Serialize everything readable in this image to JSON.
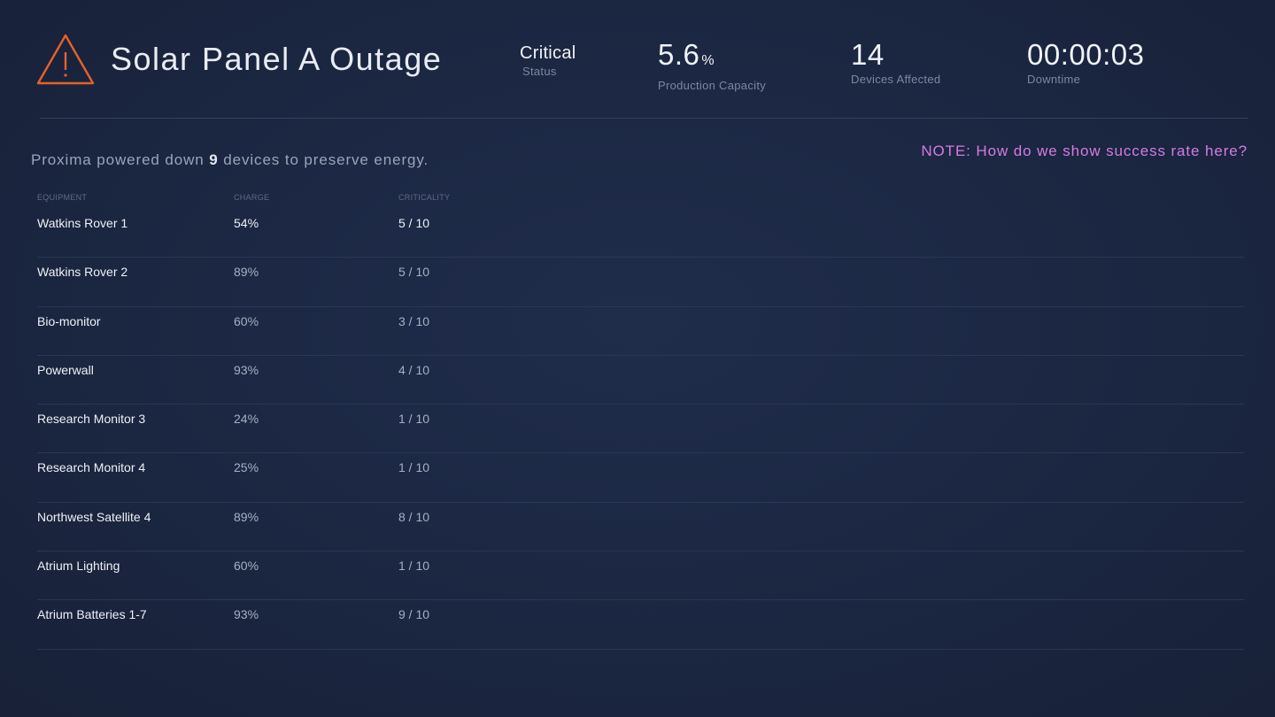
{
  "header": {
    "title": "Solar Panel A Outage",
    "icon": "warning-icon",
    "accent_color": "#e5622a",
    "stats": {
      "status": {
        "value": "Critical",
        "label": "Status"
      },
      "capacity": {
        "value": "5.6",
        "unit": "%",
        "label": "Production Capacity"
      },
      "devices": {
        "value": "14",
        "label": "Devices Affected"
      },
      "downtime": {
        "value": "00:00:03",
        "label": "Downtime"
      }
    }
  },
  "summary": {
    "prefix": "Proxima powered down ",
    "count": "9",
    "suffix": " devices to preserve energy."
  },
  "note": {
    "text": "NOTE: How do we show success rate here?",
    "color": "#d57be0"
  },
  "table": {
    "columns": [
      "EQUIPMENT",
      "CHARGE",
      "CRITICALITY"
    ],
    "rows": [
      {
        "equipment": "Watkins Rover 1",
        "charge": "54%",
        "criticality": "5 / 10"
      },
      {
        "equipment": "Watkins Rover 2",
        "charge": "89%",
        "criticality": "5 / 10"
      },
      {
        "equipment": "Bio-monitor",
        "charge": "60%",
        "criticality": "3 / 10"
      },
      {
        "equipment": "Powerwall",
        "charge": "93%",
        "criticality": "4 / 10"
      },
      {
        "equipment": "Research Monitor 3",
        "charge": "24%",
        "criticality": "1 / 10"
      },
      {
        "equipment": "Research Monitor 4",
        "charge": "25%",
        "criticality": "1 / 10"
      },
      {
        "equipment": "Northwest Satellite 4",
        "charge": "89%",
        "criticality": "8 / 10"
      },
      {
        "equipment": "Atrium Lighting",
        "charge": "60%",
        "criticality": "1 / 10"
      },
      {
        "equipment": "Atrium Batteries 1-7",
        "charge": "93%",
        "criticality": "9 / 10"
      }
    ]
  }
}
